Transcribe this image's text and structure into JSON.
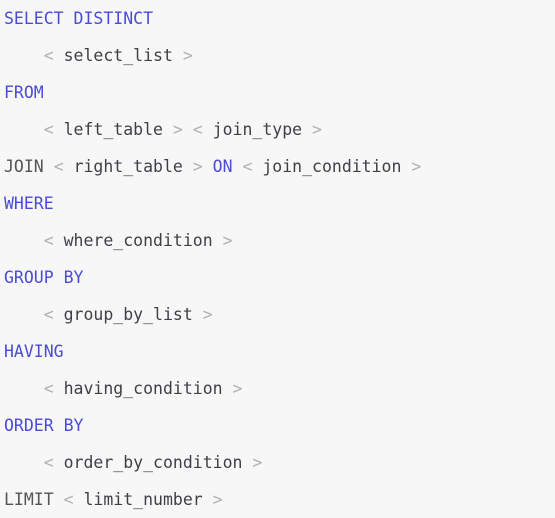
{
  "document": {
    "kind": "sql-query-template",
    "background_color": "#f7f7f7",
    "keyword_color": "#4b4bd8",
    "plain_keyword_color": "#555555",
    "bracket_color": "#b0b0b0",
    "placeholder_color": "#3f3f46"
  },
  "lines": [
    {
      "id": "line-1",
      "indent": "",
      "text": "SELECT DISTINCT",
      "tokens": [
        {
          "type": "keyword",
          "text": "SELECT"
        },
        {
          "type": "space",
          "text": " "
        },
        {
          "type": "keyword",
          "text": "DISTINCT"
        }
      ]
    },
    {
      "id": "line-2",
      "indent": "    ",
      "text": "    < select_list >",
      "tokens": [
        {
          "type": "space",
          "text": "    "
        },
        {
          "type": "bracket",
          "text": "<"
        },
        {
          "type": "space",
          "text": " "
        },
        {
          "type": "placeholder",
          "text": "select_list"
        },
        {
          "type": "space",
          "text": " "
        },
        {
          "type": "bracket",
          "text": ">"
        }
      ]
    },
    {
      "id": "line-3",
      "indent": "",
      "text": "FROM",
      "tokens": [
        {
          "type": "keyword",
          "text": "FROM"
        }
      ]
    },
    {
      "id": "line-4",
      "indent": "    ",
      "text": "    < left_table > < join_type >",
      "tokens": [
        {
          "type": "space",
          "text": "    "
        },
        {
          "type": "bracket",
          "text": "<"
        },
        {
          "type": "space",
          "text": " "
        },
        {
          "type": "placeholder",
          "text": "left_table"
        },
        {
          "type": "space",
          "text": " "
        },
        {
          "type": "bracket",
          "text": ">"
        },
        {
          "type": "space",
          "text": " "
        },
        {
          "type": "bracket",
          "text": "<"
        },
        {
          "type": "space",
          "text": " "
        },
        {
          "type": "placeholder",
          "text": "join_type"
        },
        {
          "type": "space",
          "text": " "
        },
        {
          "type": "bracket",
          "text": ">"
        }
      ]
    },
    {
      "id": "line-5",
      "indent": "",
      "text": "JOIN < right_table > ON < join_condition >",
      "tokens": [
        {
          "type": "plain-keyword",
          "text": "JOIN"
        },
        {
          "type": "space",
          "text": " "
        },
        {
          "type": "bracket",
          "text": "<"
        },
        {
          "type": "space",
          "text": " "
        },
        {
          "type": "placeholder",
          "text": "right_table"
        },
        {
          "type": "space",
          "text": " "
        },
        {
          "type": "bracket",
          "text": ">"
        },
        {
          "type": "space",
          "text": " "
        },
        {
          "type": "keyword",
          "text": "ON"
        },
        {
          "type": "space",
          "text": " "
        },
        {
          "type": "bracket",
          "text": "<"
        },
        {
          "type": "space",
          "text": " "
        },
        {
          "type": "placeholder",
          "text": "join_condition"
        },
        {
          "type": "space",
          "text": " "
        },
        {
          "type": "bracket",
          "text": ">"
        }
      ]
    },
    {
      "id": "line-6",
      "indent": "",
      "text": "WHERE",
      "tokens": [
        {
          "type": "keyword",
          "text": "WHERE"
        }
      ]
    },
    {
      "id": "line-7",
      "indent": "    ",
      "text": "    < where_condition >",
      "tokens": [
        {
          "type": "space",
          "text": "    "
        },
        {
          "type": "bracket",
          "text": "<"
        },
        {
          "type": "space",
          "text": " "
        },
        {
          "type": "placeholder",
          "text": "where_condition"
        },
        {
          "type": "space",
          "text": " "
        },
        {
          "type": "bracket",
          "text": ">"
        }
      ]
    },
    {
      "id": "line-8",
      "indent": "",
      "text": "GROUP BY",
      "tokens": [
        {
          "type": "keyword",
          "text": "GROUP"
        },
        {
          "type": "space",
          "text": " "
        },
        {
          "type": "keyword",
          "text": "BY"
        }
      ]
    },
    {
      "id": "line-9",
      "indent": "    ",
      "text": "    < group_by_list >",
      "tokens": [
        {
          "type": "space",
          "text": "    "
        },
        {
          "type": "bracket",
          "text": "<"
        },
        {
          "type": "space",
          "text": " "
        },
        {
          "type": "placeholder",
          "text": "group_by_list"
        },
        {
          "type": "space",
          "text": " "
        },
        {
          "type": "bracket",
          "text": ">"
        }
      ]
    },
    {
      "id": "line-10",
      "indent": "",
      "text": "HAVING",
      "tokens": [
        {
          "type": "keyword",
          "text": "HAVING"
        }
      ]
    },
    {
      "id": "line-11",
      "indent": "    ",
      "text": "    < having_condition >",
      "tokens": [
        {
          "type": "space",
          "text": "    "
        },
        {
          "type": "bracket",
          "text": "<"
        },
        {
          "type": "space",
          "text": " "
        },
        {
          "type": "placeholder",
          "text": "having_condition"
        },
        {
          "type": "space",
          "text": " "
        },
        {
          "type": "bracket",
          "text": ">"
        }
      ]
    },
    {
      "id": "line-12",
      "indent": "",
      "text": "ORDER BY",
      "tokens": [
        {
          "type": "keyword",
          "text": "ORDER"
        },
        {
          "type": "space",
          "text": " "
        },
        {
          "type": "keyword",
          "text": "BY"
        }
      ]
    },
    {
      "id": "line-13",
      "indent": "    ",
      "text": "    < order_by_condition >",
      "tokens": [
        {
          "type": "space",
          "text": "    "
        },
        {
          "type": "bracket",
          "text": "<"
        },
        {
          "type": "space",
          "text": " "
        },
        {
          "type": "placeholder",
          "text": "order_by_condition"
        },
        {
          "type": "space",
          "text": " "
        },
        {
          "type": "bracket",
          "text": ">"
        }
      ]
    },
    {
      "id": "line-14",
      "indent": "",
      "text": "LIMIT < limit_number >",
      "tokens": [
        {
          "type": "plain-keyword",
          "text": "LIMIT"
        },
        {
          "type": "space",
          "text": " "
        },
        {
          "type": "bracket",
          "text": "<"
        },
        {
          "type": "space",
          "text": " "
        },
        {
          "type": "placeholder",
          "text": "limit_number"
        },
        {
          "type": "space",
          "text": " "
        },
        {
          "type": "bracket",
          "text": ">"
        }
      ]
    }
  ]
}
